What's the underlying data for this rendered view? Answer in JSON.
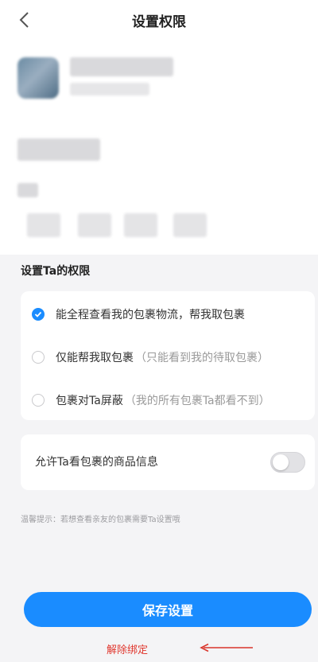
{
  "header": {
    "title": "设置权限",
    "back_icon": "chevron-left-icon"
  },
  "permissions": {
    "section_title": "设置Ta的权限",
    "options": [
      {
        "label": "能全程查看我的包裹物流，帮我取包裹",
        "hint": "",
        "checked": true
      },
      {
        "label": "仅能帮我取包裹",
        "hint": "（只能看到我的待取包裹）",
        "checked": false
      },
      {
        "label": "包裹对Ta屏蔽",
        "hint": "（我的所有包裹Ta都看不到）",
        "checked": false
      }
    ]
  },
  "goods_info": {
    "label": "允许Ta看包裹的商品信息",
    "enabled": false
  },
  "tip": "温馨提示：若想查看亲友的包裹需要Ta设置哦",
  "actions": {
    "save_label": "保存设置",
    "unbind_label": "解除绑定"
  },
  "colors": {
    "accent": "#1a8cff",
    "danger": "#e0372e"
  }
}
